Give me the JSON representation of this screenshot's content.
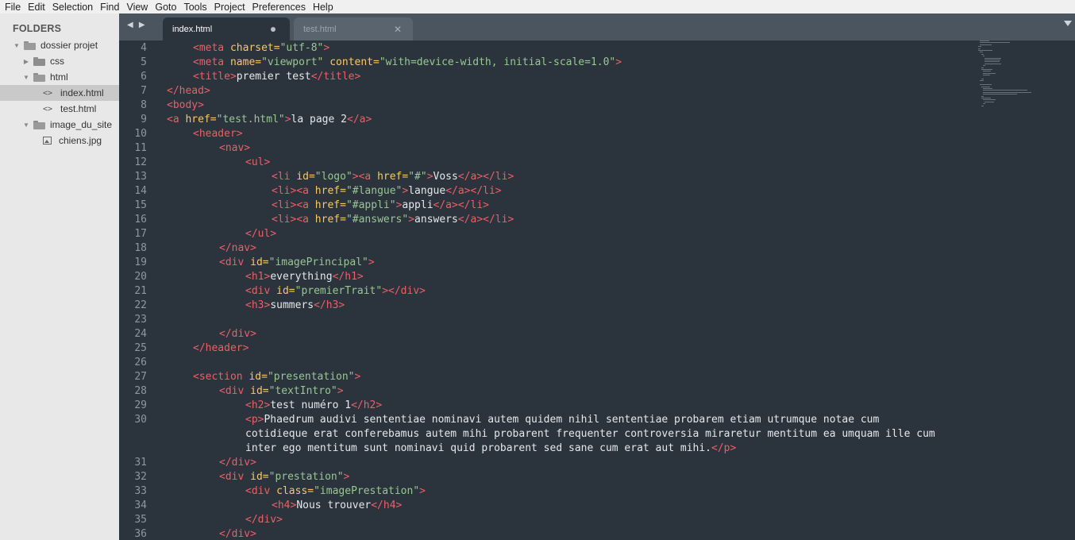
{
  "menu": [
    "File",
    "Edit",
    "Selection",
    "Find",
    "View",
    "Goto",
    "Tools",
    "Project",
    "Preferences",
    "Help"
  ],
  "sidebar": {
    "heading": "FOLDERS",
    "items": [
      {
        "label": "dossier projet",
        "type": "folder",
        "expanded": true,
        "depth": 0
      },
      {
        "label": "css",
        "type": "folder",
        "expanded": false,
        "depth": 1
      },
      {
        "label": "html",
        "type": "folder",
        "expanded": true,
        "depth": 1
      },
      {
        "label": "index.html",
        "type": "file",
        "depth": 2,
        "selected": true
      },
      {
        "label": "test.html",
        "type": "file",
        "depth": 2
      },
      {
        "label": "image_du_site",
        "type": "folder",
        "expanded": true,
        "depth": 1
      },
      {
        "label": "chiens.jpg",
        "type": "image",
        "depth": 2
      }
    ]
  },
  "tabs": [
    {
      "label": "index.html",
      "active": true,
      "modified": true
    },
    {
      "label": "test.html",
      "active": false,
      "modified": false
    }
  ],
  "editor": {
    "lines": [
      {
        "n": "4",
        "indent": 1,
        "tokens": [
          [
            "t",
            "<meta "
          ],
          [
            "a",
            "charset="
          ],
          [
            "s",
            "\"utf-8\""
          ],
          [
            "t",
            ">"
          ]
        ]
      },
      {
        "n": "5",
        "indent": 1,
        "tokens": [
          [
            "t",
            "<meta "
          ],
          [
            "a",
            "name="
          ],
          [
            "s",
            "\"viewport\""
          ],
          [
            "a",
            " content="
          ],
          [
            "s",
            "\"with=device-width, initial-scale=1.0\""
          ],
          [
            "t",
            ">"
          ]
        ]
      },
      {
        "n": "6",
        "indent": 1,
        "tokens": [
          [
            "t",
            "<title>"
          ],
          [
            "x",
            "premier test"
          ],
          [
            "t",
            "</title>"
          ]
        ]
      },
      {
        "n": "7",
        "indent": 0,
        "tokens": [
          [
            "t",
            "</head>"
          ]
        ]
      },
      {
        "n": "8",
        "indent": 0,
        "tokens": [
          [
            "t",
            "<body>"
          ]
        ]
      },
      {
        "n": "9",
        "indent": 0,
        "tokens": [
          [
            "t",
            "<a "
          ],
          [
            "a",
            "href="
          ],
          [
            "s",
            "\"test.html\""
          ],
          [
            "t",
            ">"
          ],
          [
            "x",
            "la page 2"
          ],
          [
            "t",
            "</a>"
          ]
        ]
      },
      {
        "n": "10",
        "indent": 1,
        "tokens": [
          [
            "t",
            "<header>"
          ]
        ]
      },
      {
        "n": "11",
        "indent": 2,
        "tokens": [
          [
            "t",
            "<nav>"
          ]
        ]
      },
      {
        "n": "12",
        "indent": 3,
        "tokens": [
          [
            "t",
            "<ul>"
          ]
        ]
      },
      {
        "n": "13",
        "indent": 4,
        "tokens": [
          [
            "t",
            "<li "
          ],
          [
            "a",
            "id="
          ],
          [
            "s",
            "\"logo\""
          ],
          [
            "t",
            ">"
          ],
          [
            "t",
            "<a "
          ],
          [
            "a",
            "href="
          ],
          [
            "s",
            "\"#\""
          ],
          [
            "t",
            ">"
          ],
          [
            "x",
            "Voss"
          ],
          [
            "t",
            "</a>"
          ],
          [
            "t",
            "</li>"
          ]
        ]
      },
      {
        "n": "14",
        "indent": 4,
        "tokens": [
          [
            "t",
            "<li>"
          ],
          [
            "t",
            "<a "
          ],
          [
            "a",
            "href="
          ],
          [
            "s",
            "\"#langue\""
          ],
          [
            "t",
            ">"
          ],
          [
            "x",
            "langue"
          ],
          [
            "t",
            "</a>"
          ],
          [
            "t",
            "</li>"
          ]
        ]
      },
      {
        "n": "15",
        "indent": 4,
        "tokens": [
          [
            "t",
            "<li>"
          ],
          [
            "t",
            "<a "
          ],
          [
            "a",
            "href="
          ],
          [
            "s",
            "\"#appli\""
          ],
          [
            "t",
            ">"
          ],
          [
            "x",
            "appli"
          ],
          [
            "t",
            "</a>"
          ],
          [
            "t",
            "</li>"
          ]
        ]
      },
      {
        "n": "16",
        "indent": 4,
        "tokens": [
          [
            "t",
            "<li>"
          ],
          [
            "t",
            "<a "
          ],
          [
            "a",
            "href="
          ],
          [
            "s",
            "\"#answers\""
          ],
          [
            "t",
            ">"
          ],
          [
            "x",
            "answers"
          ],
          [
            "t",
            "</a>"
          ],
          [
            "t",
            "</li>"
          ]
        ]
      },
      {
        "n": "17",
        "indent": 3,
        "tokens": [
          [
            "t",
            "</ul>"
          ]
        ]
      },
      {
        "n": "18",
        "indent": 2,
        "tokens": [
          [
            "t",
            "</nav>"
          ]
        ]
      },
      {
        "n": "19",
        "indent": 2,
        "tokens": [
          [
            "t",
            "<div "
          ],
          [
            "a",
            "id="
          ],
          [
            "s",
            "\"imagePrincipal\""
          ],
          [
            "t",
            ">"
          ]
        ]
      },
      {
        "n": "20",
        "indent": 3,
        "tokens": [
          [
            "t",
            "<h1>"
          ],
          [
            "x",
            "everything"
          ],
          [
            "t",
            "</h1>"
          ]
        ]
      },
      {
        "n": "21",
        "indent": 3,
        "tokens": [
          [
            "t",
            "<div "
          ],
          [
            "a",
            "id="
          ],
          [
            "s",
            "\"premierTrait\""
          ],
          [
            "t",
            ">"
          ],
          [
            "t",
            "</div>"
          ]
        ]
      },
      {
        "n": "22",
        "indent": 3,
        "tokens": [
          [
            "t",
            "<h3>"
          ],
          [
            "x",
            "summers"
          ],
          [
            "t",
            "</h3>"
          ]
        ]
      },
      {
        "n": "23",
        "indent": 0,
        "tokens": []
      },
      {
        "n": "24",
        "indent": 2,
        "tokens": [
          [
            "t",
            "</div>"
          ]
        ]
      },
      {
        "n": "25",
        "indent": 1,
        "tokens": [
          [
            "t",
            "</header>"
          ]
        ]
      },
      {
        "n": "26",
        "indent": 0,
        "tokens": []
      },
      {
        "n": "27",
        "indent": 1,
        "tokens": [
          [
            "t",
            "<section "
          ],
          [
            "a",
            "id="
          ],
          [
            "s",
            "\"presentation\""
          ],
          [
            "t",
            ">"
          ]
        ]
      },
      {
        "n": "28",
        "indent": 2,
        "tokens": [
          [
            "t",
            "<div "
          ],
          [
            "a",
            "id="
          ],
          [
            "s",
            "\"textIntro\""
          ],
          [
            "t",
            ">"
          ]
        ]
      },
      {
        "n": "29",
        "indent": 3,
        "tokens": [
          [
            "t",
            "<h2>"
          ],
          [
            "x",
            "test numéro 1"
          ],
          [
            "t",
            "</h2>"
          ]
        ]
      },
      {
        "n": "30",
        "indent": 3,
        "tokens": [
          [
            "t",
            "<p>"
          ],
          [
            "x",
            "Phaedrum audivi sententiae nominavi autem quidem nihil sententiae probarem etiam utrumque notae cum"
          ]
        ]
      },
      {
        "n": "",
        "indent": 3,
        "tokens": [
          [
            "x",
            "cotidieque erat conferebamus autem mihi probarent frequenter controversia miraretur mentitum ea umquam ille cum"
          ]
        ]
      },
      {
        "n": "",
        "indent": 3,
        "tokens": [
          [
            "x",
            "inter ego mentitum sunt nominavi quid probarent sed sane cum erat aut mihi."
          ],
          [
            "t",
            "</p>"
          ]
        ]
      },
      {
        "n": "31",
        "indent": 2,
        "tokens": [
          [
            "t",
            "</div>"
          ]
        ]
      },
      {
        "n": "32",
        "indent": 2,
        "tokens": [
          [
            "t",
            "<div "
          ],
          [
            "a",
            "id="
          ],
          [
            "s",
            "\"prestation\""
          ],
          [
            "t",
            ">"
          ]
        ]
      },
      {
        "n": "33",
        "indent": 3,
        "tokens": [
          [
            "t",
            "<div "
          ],
          [
            "a",
            "class="
          ],
          [
            "s",
            "\"imagePrestation\""
          ],
          [
            "t",
            ">"
          ]
        ]
      },
      {
        "n": "34",
        "indent": 4,
        "tokens": [
          [
            "t",
            "<h4>"
          ],
          [
            "x",
            "Nous trouver"
          ],
          [
            "t",
            "</h4>"
          ]
        ]
      },
      {
        "n": "35",
        "indent": 3,
        "tokens": [
          [
            "t",
            "</div>"
          ]
        ]
      },
      {
        "n": "36",
        "indent": 2,
        "tokens": [
          [
            "t",
            "</div>"
          ]
        ]
      }
    ]
  },
  "colors": {
    "background": "#2b333c",
    "tag": "#ec5f67",
    "attribute": "#fac863",
    "string": "#99c794",
    "text": "#e4e8ec",
    "line_number": "#8e969e"
  },
  "icons": {
    "nav": "nav-arrows-icon",
    "tab_dot": "unsaved-dot-icon",
    "tab_close": "close-icon",
    "tab_menu": "dropdown-icon"
  }
}
